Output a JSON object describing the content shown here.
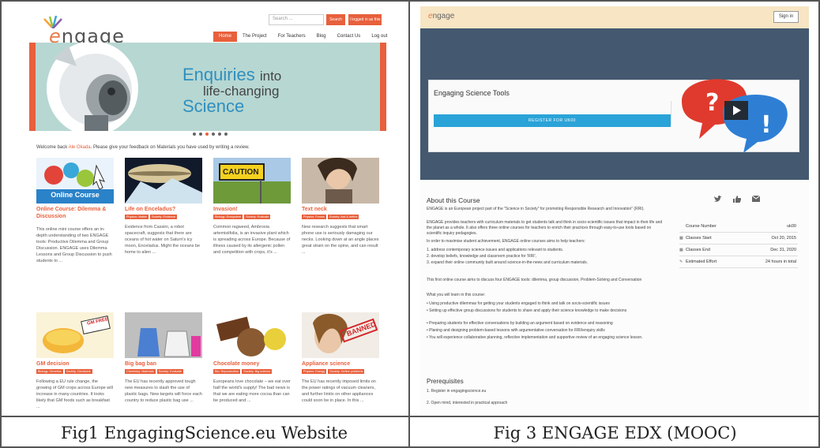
{
  "left": {
    "logo_text": "ngage",
    "logo_letter": "e",
    "search_placeholder": "Search ...",
    "search_button": "Search",
    "login_button": "I logged in as this",
    "nav": [
      "Home",
      "The Project",
      "For Teachers",
      "Blog",
      "Contact Us",
      "Log out"
    ],
    "hero": {
      "word1": "Enquiries",
      "word2": "into",
      "word3": "life-changing",
      "word4": "Science"
    },
    "welcome_prefix": "Welcome back",
    "welcome_name": "Ale Okada",
    "welcome_suffix": ". Please give your feedback on Materials you have used by writing a review.",
    "cards": [
      {
        "title": "Online Course: Dilemma & Discussion",
        "tags": [],
        "desc": "This online mini course offers an in-depth understanding of two ENGAGE tools: Productive Dilemma and Group Discussion. ENGAGE uses Dilemma Lessons and Group Discussion to push students to ...",
        "thumb_label": "Online Course"
      },
      {
        "title": "Life on Enceladus?",
        "tags": [
          "Physics: Matter",
          "Society: Evidence"
        ],
        "desc": "Evidence from Cassini, a robot spacecraft, suggests that there are oceans of hot water on Saturn's icy moon, Enceladus. Might the oceans be home to alien ..."
      },
      {
        "title": "Invasion!",
        "tags": [
          "Biology: Ecosystem",
          "Society: Evaluate"
        ],
        "desc": "Common ragweed, Ambrosia artemisiifolia, is an invasive plant which is spreading across Europe. Because of illness caused by its allergenic pollen and competition with crops, it's ...",
        "thumb_label": "CAUTION"
      },
      {
        "title": "Text neck",
        "tags": [
          "Physics: Forces",
          "Society: Ask & define"
        ],
        "desc": "New research suggests that smart phone use is seriously damaging our necks. Looking down at an angle places great strain on the spine, and can result ..."
      },
      {
        "title": "GM decision",
        "tags": [
          "Biology: Genetics",
          "Society: Decisions"
        ],
        "desc": "Following a EU rule change, the growing of GM crops across Europe will increase in many countries. It looks likely that GM foods such as breakfast ...",
        "thumb_label": "GM FREE"
      },
      {
        "title": "Big bag ban",
        "tags": [
          "Chemistry: Materials",
          "Society: Evaluate"
        ],
        "desc": "The EU has recently approved tough new measures to slash the use of plastic bags. New targets will force each country to reduce plastic bag use ..."
      },
      {
        "title": "Chocolate money",
        "tags": [
          "Bio: Reproduction",
          "Society: Big science"
        ],
        "desc": "Europeans love chocolate – we eat over half the world's supply! The bad news is that we are eating more cocoa than can be produced and ..."
      },
      {
        "title": "Appliance science",
        "tags": [
          "Physics: Energy",
          "Society: Define problems"
        ],
        "desc": "The EU has recently imposed limits on the power ratings of vacuum cleaners, and further limits on other appliances could soon be in place. In this ...",
        "thumb_label": "BANNED"
      }
    ]
  },
  "right": {
    "logo_text": "ngage",
    "logo_letter": "e",
    "signin": "Sign in",
    "course_title": "Engaging Science Tools",
    "register_button": "REGISTER FOR UK00",
    "about_heading": "About this Course",
    "para1": "ENGAGE is an European project part of the \"Science in Society\" for promoting Responsible Research and Innovation\" (RRI).",
    "para2": "ENGAGE provides teachers with curriculum materials to get students talk and think in socio-scientific issues that impact in their life and the planet as a whole. It also offers three online courses for teachers to enrich their practices through easy-to-use tools based on scientific inquiry pedagogies.",
    "para3": "In order to maximise student achievement, ENGAGE online courses aims to help teachers:",
    "list1": [
      "1.  address contemporary science issues and applications relevant to students.",
      "2. develop beliefs, knowledge and classroom practice for 'RRI',",
      "3. expand their online community built around science-in-the-news and curriculum materials."
    ],
    "para4": "This first online course aims to discuss four ENGAGE tools: dilemma, group discussion, Problem-Solving and Conversation",
    "para5": "What you will learn in this course:",
    "list2": [
      "• Using productive dilemmas for getting your students engaged to think and talk on socio-scientific issues",
      "• Setting up effective group discussions for students to share and apply their science knowledge to make decisions",
      "• Preparing students for effective conversations by building an argument based on evidence and reasoning",
      "• Planing and designing problem-based lessons with argumentative conversation for RRI/enquiry skills",
      "• You will experience collaborative planning, reflective implementation and supportive review of an engaging science lesson."
    ],
    "prereq_heading": "Prerequisites",
    "prereq": [
      "1. Register in engagingscience.eu",
      "2. Open mind, interested in practical approach"
    ],
    "facts": [
      {
        "key": "Course Number",
        "value": "uk00",
        "icon": ""
      },
      {
        "key": "Classes Start",
        "value": "Oct 20, 2015",
        "icon": "calendar-icon"
      },
      {
        "key": "Classes End",
        "value": "Dec 31, 2020",
        "icon": "calendar-icon"
      },
      {
        "key": "Estimated Effort",
        "value": "24 hours in total",
        "icon": "pencil-icon"
      }
    ]
  },
  "captions": {
    "left": "Fig1 EngagingScience.eu Website",
    "right": "Fig 3 ENGAGE EDX (MOOC)"
  }
}
